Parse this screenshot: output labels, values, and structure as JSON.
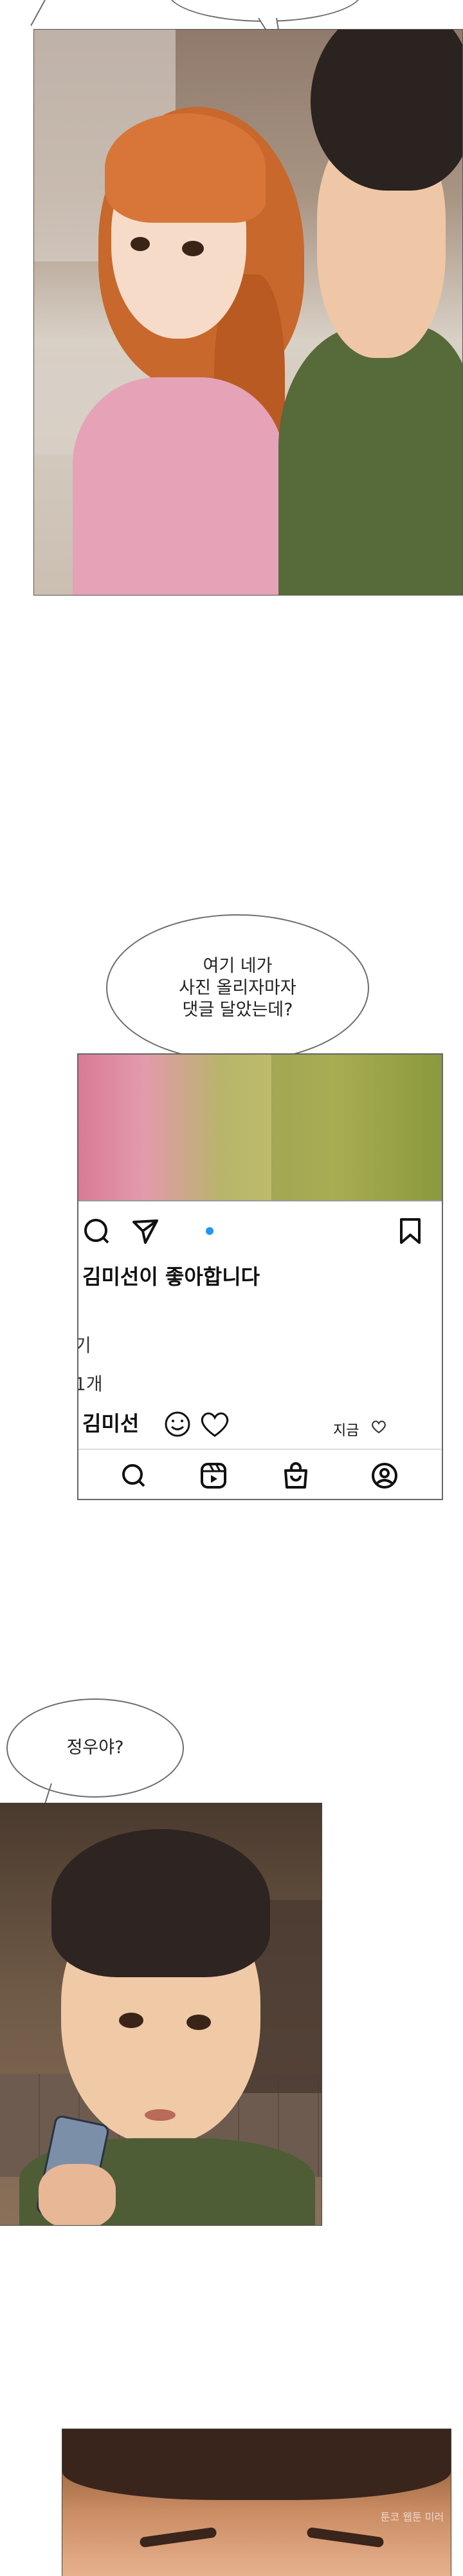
{
  "bubbles": {
    "b1": {
      "text": "여기 네가\n사진 올리자마자\n댓글 달았는데?"
    },
    "b2": {
      "text": "정우야?"
    }
  },
  "post": {
    "likes_line": "김미선이 좋아합니다",
    "fragment_line_1": "기",
    "fragment_line_2": "1개",
    "comment_author": "김미선",
    "timestamp": "지금",
    "icons": [
      "search-icon",
      "send-icon",
      "carousel-dot-icon",
      "bookmark-icon",
      "smile-icon",
      "heart-icon",
      "small-heart-icon",
      "nav-search-icon",
      "reels-icon",
      "shop-icon",
      "profile-icon"
    ]
  },
  "watermark": {
    "text": "툰코 웹툰 미러"
  },
  "colors": {
    "bubble_border": "#6d6d6d",
    "post_dot": "#2196f3",
    "panel_border": "#555555"
  }
}
